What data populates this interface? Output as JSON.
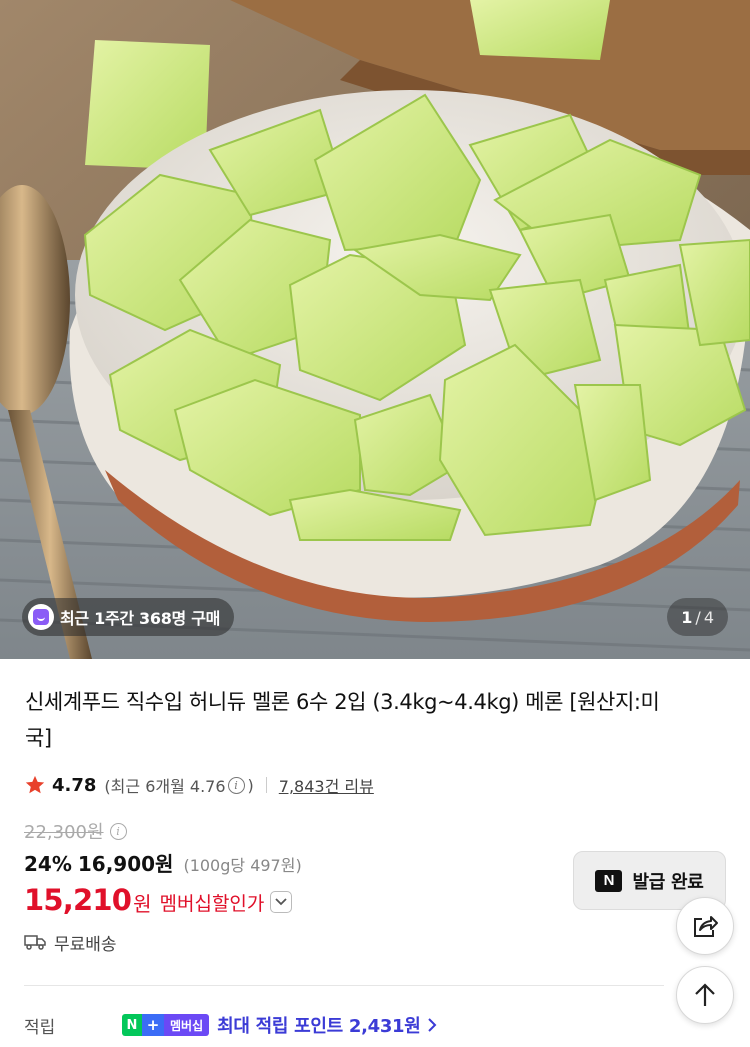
{
  "gallery": {
    "recent_purchase_text": "최근 1주간 368명 구매",
    "current_page": "1",
    "separator": "/",
    "total_pages": "4",
    "icons": [
      "bag-icon"
    ]
  },
  "product": {
    "title": "신세계푸드 직수입 허니듀 멜론 6수 2입 (3.4kg~4.4kg) 메론 [원산지:미국]",
    "rating": "4.78",
    "recent_rating_prefix": "(최근 6개월 4.76",
    "recent_rating_suffix": ")",
    "review_count": "7,843건 리뷰",
    "original_price": "22,300원",
    "discount_rate": "24%",
    "sale_price": "16,900원",
    "unit_price": "(100g당 497원)",
    "member_price": "15,210",
    "member_won": "원",
    "member_price_label": "멤버십할인가",
    "shipping": "무료배송"
  },
  "coupon": {
    "badge": "N",
    "label": "발급 완료"
  },
  "points": {
    "label": "적립",
    "badge_n": "N",
    "badge_plus": "+",
    "badge_membership": "멤버십",
    "text": "최대 적립 포인트 2,431원"
  },
  "colors": {
    "accent_red": "#e0102a",
    "points_blue": "#3b3bd6",
    "star": "#e8412c",
    "naver_green": "#03c75a",
    "membership_purple": "#6b49f5"
  },
  "icons": [
    "star-icon",
    "info-icon",
    "chevron-down-icon",
    "truck-icon",
    "share-icon",
    "arrow-up-icon",
    "chevron-right-icon"
  ]
}
